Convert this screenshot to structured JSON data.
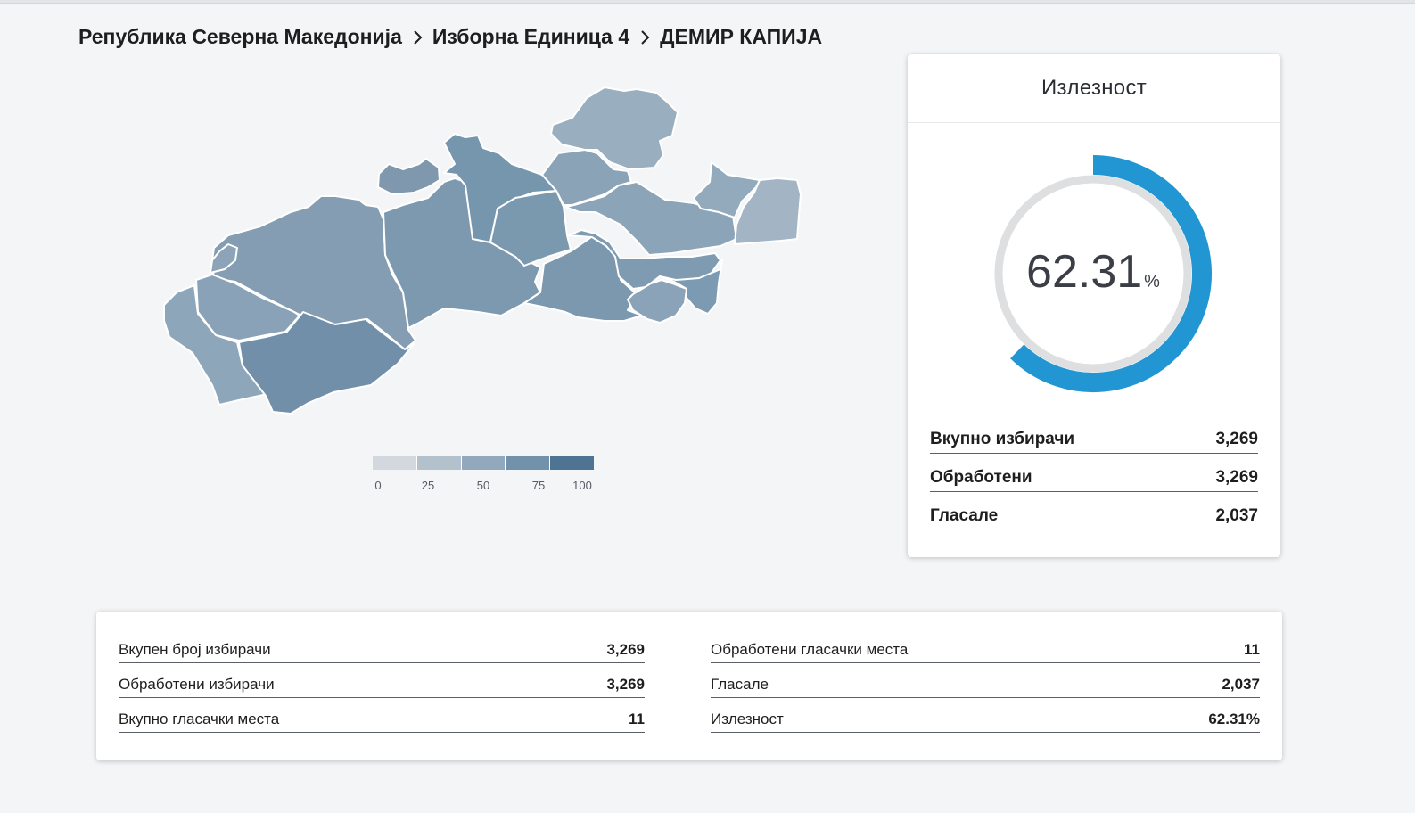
{
  "breadcrumb": {
    "items": [
      "Република Северна Македонија",
      "Изборна Единица 4",
      "ДЕМИР КАПИЈА"
    ]
  },
  "map": {
    "legend": {
      "colors": [
        "#d3d8de",
        "#b3c1cd",
        "#92a9bd",
        "#7292ab",
        "#4f7393"
      ],
      "ticks": [
        "0",
        "25",
        "50",
        "75",
        "100"
      ]
    }
  },
  "turnout": {
    "title": "Излезност",
    "percent": "62.31",
    "percent_sign": "%",
    "fraction": 0.6231,
    "accent": "#2296d3",
    "track": "#dedfe1",
    "stats": [
      {
        "label": "Вкупно избирачи",
        "value": "3,269"
      },
      {
        "label": "Обработени",
        "value": "3,269"
      },
      {
        "label": "Гласале",
        "value": "2,037"
      }
    ]
  },
  "summary": {
    "left": [
      {
        "label": "Вкупен број избирачи",
        "value": "3,269"
      },
      {
        "label": "Обработени избирачи",
        "value": "3,269"
      },
      {
        "label": "Вкупно гласачки места",
        "value": "11"
      }
    ],
    "right": [
      {
        "label": "Обработени гласачки места",
        "value": "11"
      },
      {
        "label": "Гласале",
        "value": "2,037"
      },
      {
        "label": "Излезност",
        "value": "62.31%"
      }
    ]
  }
}
